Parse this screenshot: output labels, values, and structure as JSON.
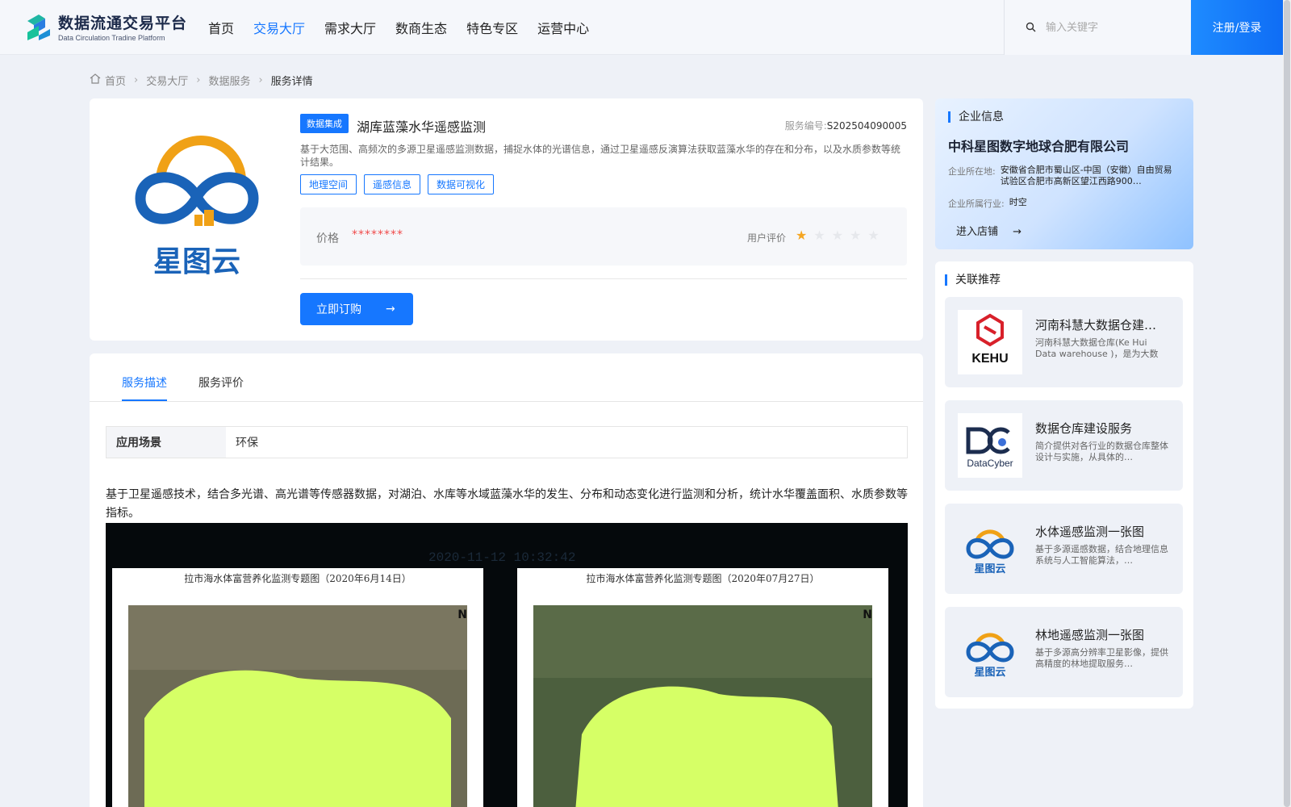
{
  "header": {
    "logo_title": "数据流通交易平台",
    "logo_sub": "Data Circulation Tradine Platform",
    "nav": [
      "首页",
      "交易大厅",
      "需求大厅",
      "数商生态",
      "特色专区",
      "运营中心"
    ],
    "active_nav": "交易大厅",
    "search_placeholder": "输入关键字",
    "login_label": "注册/登录"
  },
  "breadcrumb": [
    "首页",
    "交易大厅",
    "数据服务",
    "服务详情"
  ],
  "product": {
    "type_tag": "数据集成",
    "title": "湖库蓝藻水华遥感监测",
    "serial_label": "服务编号:",
    "serial": "S202504090005",
    "description": "基于大范围、高频次的多源卫星遥感监测数据，捕捉水体的光谱信息，通过卫星遥感反演算法获取蓝藻水华的存在和分布，以及水质参数等统计结果。",
    "tags": [
      "地理空间",
      "遥感信息",
      "数据可视化"
    ],
    "price_label": "价格",
    "price_value": "********",
    "rating_label": "用户评价",
    "rating": 1,
    "rating_max": 5,
    "buy_label": "立即订购",
    "logo_text": "星图云"
  },
  "tabs": [
    "服务描述",
    "服务评价"
  ],
  "active_tab": "服务描述",
  "details": {
    "scene_label": "应用场景",
    "scene_value": "环保",
    "text": "基于卫星遥感技术，结合多光谱、高光谱等传感器数据，对湖泊、水库等水域蓝藻水华的发生、分布和动态变化进行监测和分析，统计水华覆盖面积、水质参数等指标。",
    "image": {
      "timestamp": "2020-11-12 10:32:42",
      "panel_left_title": "拉市海水体富营养化监测专题图（2020年6月14日）",
      "panel_right_title": "拉市海水体富营养化监测专题图（2020年07月27日）",
      "north": "N",
      "lake_color": "#d6ff66"
    }
  },
  "company": {
    "section_title": "企业信息",
    "name": "中科星图数字地球合肥有限公司",
    "location_label": "企业所在地:",
    "location": "安徽省合肥市蜀山区-中国（安徽）自由贸易试验区合肥市高新区望江西路900…",
    "industry_label": "企业所属行业:",
    "industry": "时空",
    "enter_label": "进入店铺"
  },
  "recommend": {
    "section_title": "关联推荐",
    "items": [
      {
        "title": "河南科慧大数据仓建…",
        "desc": "河南科慧大数据仓库(Ke Hui Data warehouse )，是为大数据…",
        "logo": "KEHU"
      },
      {
        "title": "数据仓库建设服务",
        "desc": "简介提供对各行业的数据仓库整体设计与实施，从具体的…",
        "logo": "DataCyber"
      },
      {
        "title": "水体遥感监测一张图",
        "desc": "基于多源遥感数据，结合地理信息系统与人工智能算法，…",
        "logo": "星图云"
      },
      {
        "title": "林地遥感监测一张图",
        "desc": "基于多源高分辨率卫星影像，提供高精度的林地提取服务…",
        "logo": "星图云"
      }
    ]
  },
  "colors": {
    "accent": "#1677ff",
    "price": "#f04a4a",
    "star": "#f5a623"
  }
}
